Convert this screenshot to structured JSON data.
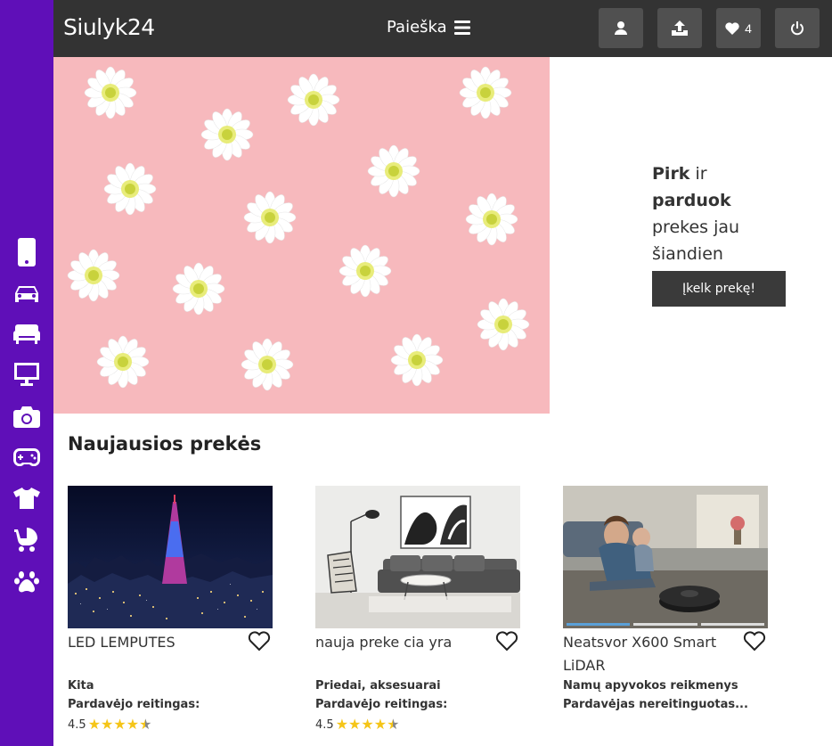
{
  "header": {
    "brand": "Siulyk24",
    "search_label": "Paieška",
    "favorites_count": "4"
  },
  "sidebar": {
    "items": [
      {
        "icon": "phone-icon"
      },
      {
        "icon": "car-icon"
      },
      {
        "icon": "sofa-icon"
      },
      {
        "icon": "monitor-icon"
      },
      {
        "icon": "camera-icon"
      },
      {
        "icon": "gamepad-icon"
      },
      {
        "icon": "tshirt-icon"
      },
      {
        "icon": "stroller-icon"
      },
      {
        "icon": "paw-icon"
      }
    ],
    "color": "#5f0fb8"
  },
  "hero": {
    "line1_bold": "Pirk",
    "line1_rest": "ir",
    "line2_bold": "parduok",
    "line3": "prekes jau",
    "line4": "šiandien",
    "button": "Įkelk prekę!"
  },
  "section": {
    "title": "Naujausios prekės"
  },
  "products": [
    {
      "title": "LED LEMPUTES",
      "category": "Kita",
      "seller_label": "Pardavėjo reitingas:",
      "rating": "4.5"
    },
    {
      "title": "nauja preke cia yra",
      "category": "Priedai, aksesuarai",
      "seller_label": "Pardavėjo reitingas:",
      "rating": "4.5"
    },
    {
      "title": "Neatsvor X600 Smart LiDAR",
      "category": "Namų apyvokos reikmenys",
      "seller_label": "Pardavėjas nereitinguotas..."
    }
  ]
}
